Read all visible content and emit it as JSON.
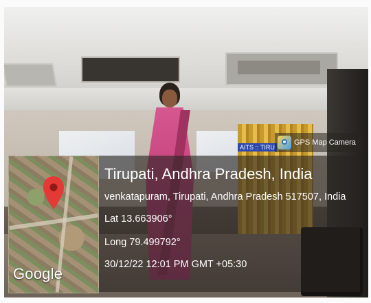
{
  "overlay": {
    "title": "Tirupati, Andhra Pradesh, India",
    "address": "venkatapuram, Tirupati, Andhra Pradesh 517507, India",
    "latitude": "Lat 13.663906°",
    "longitude": "Long 79.499792°",
    "datetime": "30/12/22 12:01 PM GMT +05:30"
  },
  "map": {
    "brand": "Google",
    "pin_icon": "location-pin-icon",
    "pin_color": "#e53935"
  },
  "app_badge": {
    "label": "GPS Map Camera",
    "icon": "gps-map-camera-app-icon"
  },
  "banner_tag": {
    "text": "AITS :: TIRU"
  },
  "colors": {
    "overlay_bg": "rgba(40,36,33,0.62)",
    "saree": "#c8447f"
  }
}
